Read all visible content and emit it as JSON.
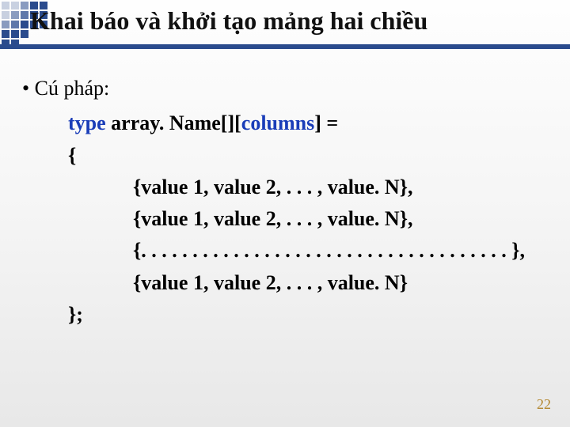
{
  "slide": {
    "title": "Khai báo và khởi tạo mảng hai chiều",
    "bullet": "• Cú pháp:",
    "syntax": {
      "type_kw": "type",
      "mid": " array. Name[][",
      "cols_kw": "columns",
      "tail": "] ="
    },
    "open_brace": "{",
    "rows": [
      "{value 1, value 2, . . . , value. N},",
      "{value 1, value 2, . . . , value. N},",
      "{. . . . . . . . . . . . . . . . . . . . . . . . . . . . . . . . . . . . },",
      "{value 1, value 2, . . . , value. N}"
    ],
    "close": "};",
    "page": "22"
  }
}
